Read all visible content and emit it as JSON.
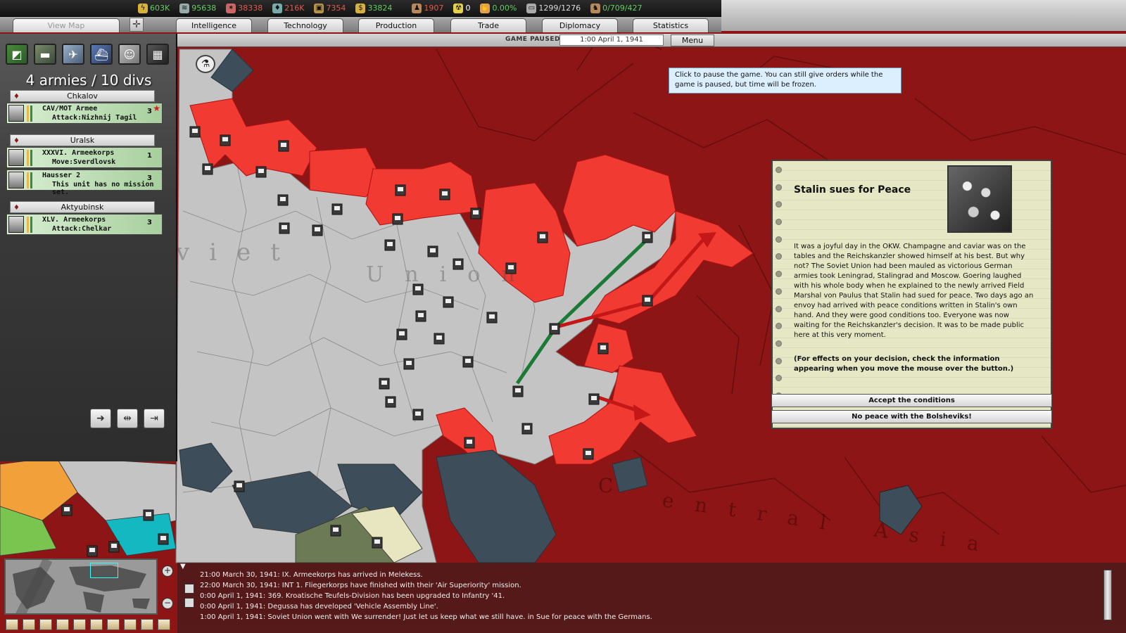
{
  "resources": [
    {
      "name": "energy",
      "icon": "lightning-icon",
      "value": "603K",
      "color": "#5fd15f"
    },
    {
      "name": "metal",
      "icon": "metal-icon",
      "value": "95638",
      "color": "#5fd15f"
    },
    {
      "name": "rare_materials",
      "icon": "rare-materials-icon",
      "value": "38338",
      "color": "#e55a4a"
    },
    {
      "name": "oil",
      "icon": "oil-drop-icon",
      "value": "216K",
      "color": "#e55a4a"
    },
    {
      "name": "supplies",
      "icon": "supplies-crate-icon",
      "value": "7354",
      "color": "#e55a4a"
    },
    {
      "name": "money",
      "icon": "dollar-icon",
      "value": "33824",
      "color": "#5fd15f"
    },
    {
      "name": "manpower",
      "icon": "manpower-icon",
      "value": "1907",
      "color": "#e55a4a"
    },
    {
      "name": "nuclear",
      "icon": "nuclear-icon",
      "value": "0",
      "color": "#ffffff"
    },
    {
      "name": "dissent",
      "icon": "dissent-icon",
      "value": "0.00%",
      "color": "#5fd15f"
    },
    {
      "name": "transport",
      "icon": "transport-icon",
      "value": "1299/1276",
      "color": "#dddddd"
    },
    {
      "name": "officers",
      "icon": "officers-icon",
      "value": "0/709/427",
      "color": "#5fd15f"
    }
  ],
  "tabs": {
    "view_map": "View Map",
    "intelligence": "Intelligence",
    "technology": "Technology",
    "production": "Production",
    "trade": "Trade",
    "diplomacy": "Diplomacy",
    "statistics": "Statistics"
  },
  "status": {
    "paused": "GAME PAUSED",
    "date": "1:00 April 1, 1941",
    "menu": "Menu"
  },
  "tooltip": "Click to pause the game. You can still give orders while the game is paused, but time will be frozen.",
  "armies": {
    "title": "4 armies / 10 divs",
    "groups": [
      {
        "hq": "Chkalov",
        "units": [
          {
            "name": "CAV/MOT Armee",
            "mission": "Attack:Nizhnij Tagil",
            "count": "3"
          }
        ]
      },
      {
        "hq": "Uralsk",
        "units": [
          {
            "name": "XXXVI. Armeekorps",
            "mission": "Move:Sverdlovsk",
            "count": "1"
          },
          {
            "name": "Hausser 2",
            "mission": "This unit has no mission set.",
            "count": "3"
          }
        ]
      },
      {
        "hq": "Aktyubinsk",
        "units": [
          {
            "name": "XLV. Armeekorps",
            "mission": "Attack:Chelkar",
            "count": "3"
          }
        ]
      }
    ]
  },
  "map_labels": {
    "soviet": "viet",
    "union": "Union",
    "central_asia_c": "C",
    "central_asia": "entral Asia"
  },
  "event": {
    "title": "Stalin sues for Peace",
    "text": "It was a joyful day in the OKW. Champagne and caviar was on the tables and the Reichskanzler showed himself at his best. But why not? The Soviet Union had been mauled as victorious German armies took Leningrad, Stalingrad and Moscow. Goering laughed with his whole body when he explained to the newly arrived Field Marshal von Paulus that Stalin had sued for peace. Two days ago an envoy had arrived with peace conditions written in Stalin's own hand. And they were good conditions too. Everyone was now waiting for the Reichskanzler's decision. It was to be made public here at this very moment.",
    "note": "(For effects on your decision, check the information appearing when you move the mouse over the button.)",
    "accept": "Accept the conditions",
    "reject": "No peace with the Bolsheviks!"
  },
  "log": [
    "21:00 March 30, 1941: IX. Armeekorps has arrived in Melekess.",
    "22:00 March 30, 1941: INT 1. Fliegerkorps have finished with their 'Air Superiority' mission.",
    "0:00 April 1, 1941: 369. Kroatische Teufels-Division has been upgraded to Infantry '41.",
    "0:00 April 1, 1941: Degussa has developed 'Vehicle Assembly Line'.",
    "1:00 April 1, 1941: Soviet Union went with We surrender! Just let us keep what we still have. in Sue for peace with the Germans."
  ],
  "colors": {
    "enemy_dark_red": "#8e1515",
    "captured_red": "#f03a32",
    "soviet_grey": "#c4c4c4",
    "sea": "#3d4e5a",
    "friendly_arrow": "#1b7a35",
    "attack_arrow": "#c41818"
  }
}
